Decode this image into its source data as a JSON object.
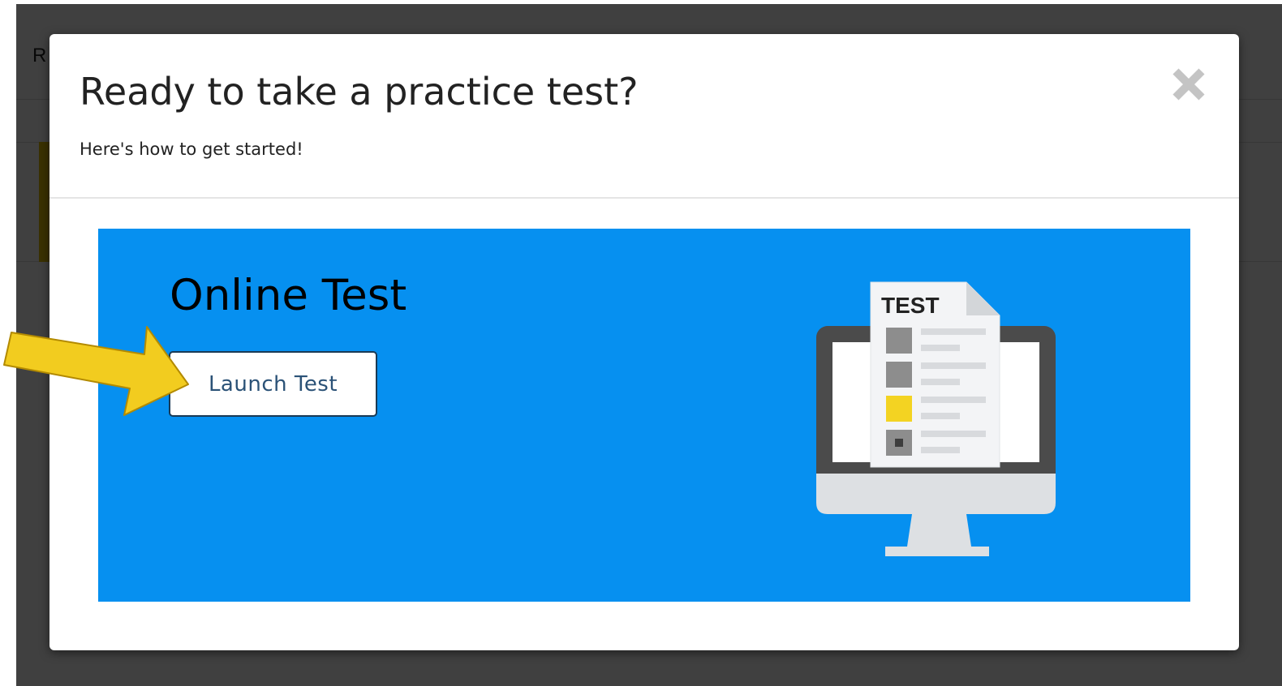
{
  "background": {
    "partial_text": "R"
  },
  "modal": {
    "title": "Ready to take a practice test?",
    "subtitle": "Here's how to get started!",
    "close_label": "×"
  },
  "banner": {
    "heading": "Online Test",
    "launch_label": "Launch Test",
    "illustration_label": "TEST",
    "background_color": "#0690f0"
  },
  "annotation": {
    "arrow_color": "#f2cc1f",
    "arrow_icon": "arrow-right-icon"
  },
  "colors": {
    "overlay": "#3b3b3b",
    "modal_bg": "#ffffff",
    "button_text": "#2b5277",
    "close_icon": "#c4c4c4"
  }
}
